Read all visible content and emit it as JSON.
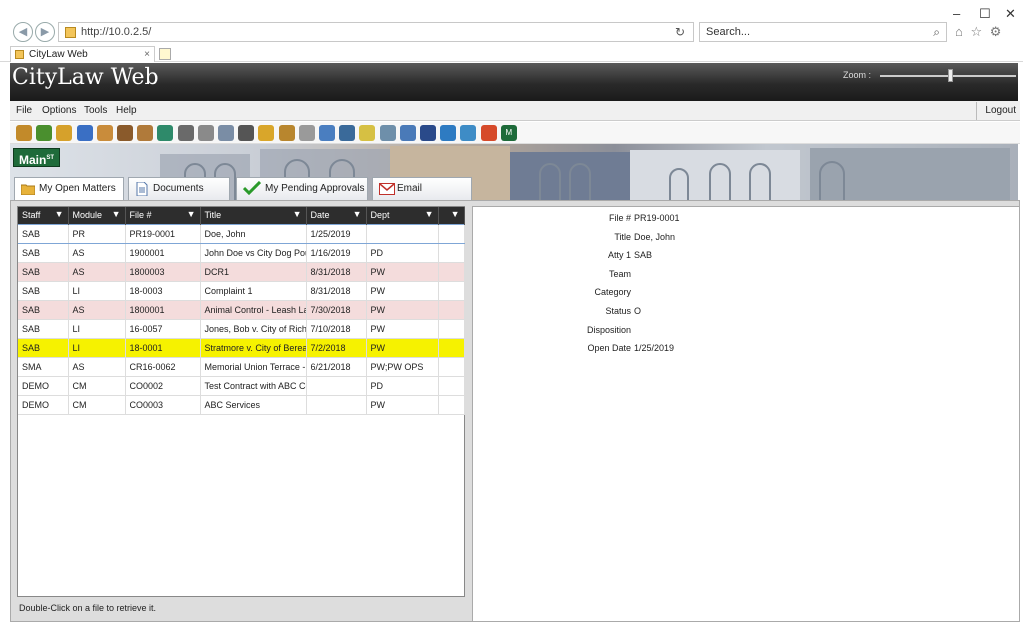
{
  "browser": {
    "url": "http://10.0.2.5/",
    "search_placeholder": "Search...",
    "tab_title": "CityLaw Web",
    "tab_close": "×",
    "refresh": "↻",
    "search_icon": "⌕",
    "minimize": "–",
    "maximize": "☐",
    "close": "✕",
    "home_star_gear": "⌂ ☆ ⚙"
  },
  "app": {
    "title": "CityLaw Web",
    "zoom_label": "Zoom :",
    "zoom_level": 0.52
  },
  "menu": {
    "items": [
      "File",
      "Options",
      "Tools",
      "Help"
    ],
    "logout": "Logout"
  },
  "toolbar": {
    "icons": [
      "gavel-icon",
      "pencil-icon",
      "folder-icon",
      "lock-icon",
      "hand-icon",
      "shoe-icon",
      "bag-icon",
      "paint-icon",
      "tools-icon",
      "clock-icon",
      "radio-icon",
      "printer-icon",
      "folder-open-icon",
      "book-icon",
      "pen-icon",
      "eraser-icon",
      "wrench-icon",
      "notebook-icon",
      "magnifier-icon",
      "doc-icon",
      "arrow-icon",
      "globe-icon",
      "refresh-icon",
      "grid-icon",
      "ms-icon"
    ],
    "icon_colors": [
      "#c28a2a",
      "#4a8f2e",
      "#d6a12b",
      "#3a6fc4",
      "#c98c3b",
      "#8a5a2b",
      "#b07a3a",
      "#2e8a6a",
      "#6a6a6a",
      "#8a8a8a",
      "#7a8da5",
      "#555555",
      "#d9a62a",
      "#b8862e",
      "#9a9a9a",
      "#4a7ec0",
      "#3a6a9a",
      "#d6c043",
      "#6e8faa",
      "#4a7ab8",
      "#2a4a8a",
      "#2e7bc2",
      "#3e8cc6",
      "#d64a2a",
      "#1e6b3a"
    ],
    "ms_label": "M"
  },
  "banner": {
    "main_label": "Main",
    "main_sup": "ST"
  },
  "tabs": [
    {
      "label": "My Open Matters",
      "active": true
    },
    {
      "label": "Documents",
      "active": false
    },
    {
      "label": "My Pending Approvals",
      "active": false
    },
    {
      "label": "Email",
      "active": false
    }
  ],
  "grid": {
    "columns": [
      "Staff",
      "Module",
      "File #",
      "Title",
      "Date",
      "Dept"
    ],
    "rows": [
      {
        "staff": "SAB",
        "module": "PR",
        "file": "PR19-0001",
        "title": "Doe, John",
        "date": "1/25/2019",
        "dept": "",
        "style": "sel"
      },
      {
        "staff": "SAB",
        "module": "AS",
        "file": "1900001",
        "title": "John Doe vs City Dog Poun",
        "date": "1/16/2019",
        "dept": "PD",
        "style": "normal"
      },
      {
        "staff": "SAB",
        "module": "AS",
        "file": "1800003",
        "title": "DCR1",
        "date": "8/31/2018",
        "dept": "PW",
        "style": "pink"
      },
      {
        "staff": "SAB",
        "module": "LI",
        "file": "18-0003",
        "title": "Complaint 1",
        "date": "8/31/2018",
        "dept": "PW",
        "style": "normal"
      },
      {
        "staff": "SAB",
        "module": "AS",
        "file": "1800001",
        "title": "Animal Control - Leash Lav",
        "date": "7/30/2018",
        "dept": "PW",
        "style": "pink"
      },
      {
        "staff": "SAB",
        "module": "LI",
        "file": "16-0057",
        "title": "Jones, Bob v. City of Richm",
        "date": "7/10/2018",
        "dept": "PW",
        "style": "normal"
      },
      {
        "staff": "SAB",
        "module": "LI",
        "file": "18-0001",
        "title": "Stratmore v. City of Berea",
        "date": "7/2/2018",
        "dept": "PW",
        "style": "yellow"
      },
      {
        "staff": "SMA",
        "module": "AS",
        "file": "CR16-0062",
        "title": "Memorial Union Terrace -",
        "date": "6/21/2018",
        "dept": "PW;PW OPS",
        "style": "normal"
      },
      {
        "staff": "DEMO",
        "module": "CM",
        "file": "CO0002",
        "title": "Test Contract with ABC Co",
        "date": "",
        "dept": "PD",
        "style": "normal"
      },
      {
        "staff": "DEMO",
        "module": "CM",
        "file": "CO0003",
        "title": "ABC Services",
        "date": "",
        "dept": "PW",
        "style": "normal"
      }
    ],
    "hint": "Double-Click on a file to retrieve it."
  },
  "details": [
    {
      "label": "File #",
      "value": "PR19-0001"
    },
    {
      "label": "Title",
      "value": "Doe, John"
    },
    {
      "label": "Atty 1",
      "value": "SAB"
    },
    {
      "label": "Team",
      "value": ""
    },
    {
      "label": "Category",
      "value": ""
    },
    {
      "label": "Status",
      "value": "O"
    },
    {
      "label": "Disposition",
      "value": ""
    },
    {
      "label": "Open Date",
      "value": "1/25/2019"
    }
  ]
}
